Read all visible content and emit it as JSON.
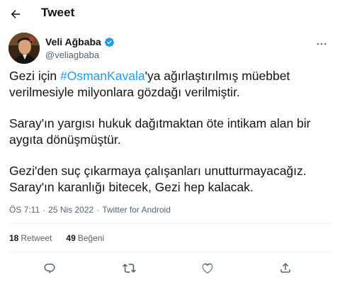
{
  "header": {
    "title": "Tweet"
  },
  "author": {
    "name": "Veli Ağbaba",
    "handle": "@veliagbaba",
    "verified_color": "#1d9bf0"
  },
  "tweet": {
    "p1_before": "Gezi için ",
    "hashtag": "#OsmanKavala",
    "p1_after": "'ya ağırlaştırılmış müebbet verilmesiyle milyonlara gözdağı verilmiştir.",
    "p2": "Saray'ın yargısı hukuk dağıtmaktan öte intikam alan bir aygıta dönüşmüştür.",
    "p3": "Gezi'den suç çıkarmaya çalışanları unutturmayacağız. Saray'ın karanlığı bitecek, Gezi hep kalacak."
  },
  "meta": {
    "time": "ÖS 7:11",
    "separator": "·",
    "date": "25 Nis 2022",
    "source": "Twitter for Android"
  },
  "stats": {
    "retweets_count": "18",
    "retweets_label": "Retweet",
    "likes_count": "49",
    "likes_label": "Beğeni"
  },
  "icons": {
    "back": "arrow-left-icon",
    "verified": "verified-badge-icon",
    "more": "more-horizontal-icon",
    "reply": "reply-icon",
    "retweet": "retweet-icon",
    "like": "heart-icon",
    "share": "share-icon"
  },
  "colors": {
    "accent": "#1d9bf0",
    "text": "#0f1419",
    "secondary": "#536471"
  }
}
